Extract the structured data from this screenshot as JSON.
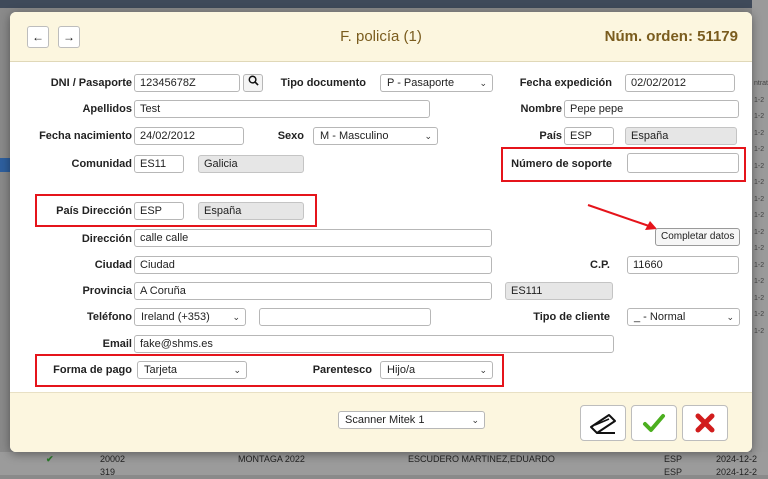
{
  "header": {
    "title": "F. policía (1)",
    "order_label": "Núm. orden: 51179",
    "prev_label": "←",
    "next_label": "→"
  },
  "form": {
    "dni_label": "DNI / Pasaporte",
    "dni_value": "12345678Z",
    "tipo_doc_label": "Tipo documento",
    "tipo_doc_value": "P - Pasaporte",
    "fecha_exp_label": "Fecha expedición",
    "fecha_exp_value": "02/02/2012",
    "apellidos_label": "Apellidos",
    "apellidos_value": "Test",
    "nombre_label": "Nombre",
    "nombre_value": "Pepe pepe",
    "fecha_nac_label": "Fecha nacimiento",
    "fecha_nac_value": "24/02/2012",
    "sexo_label": "Sexo",
    "sexo_value": "M - Masculino",
    "pais_label": "País",
    "pais_code": "ESP",
    "pais_name": "España",
    "comunidad_label": "Comunidad",
    "comunidad_code": "ES11",
    "comunidad_name": "Galicia",
    "num_soporte_label": "Número de soporte",
    "num_soporte_value": "",
    "pais_dir_label": "País Dirección",
    "pais_dir_code": "ESP",
    "pais_dir_name": "España",
    "completar_label": "Completar datos",
    "direccion_label": "Dirección",
    "direccion_value": "calle calle",
    "ciudad_label": "Ciudad",
    "ciudad_value": "Ciudad",
    "cp_label": "C.P.",
    "cp_value": "11660",
    "provincia_label": "Provincia",
    "provincia_value": "A Coruña",
    "provincia_code": "ES111",
    "telefono_label": "Teléfono",
    "telefono_prefix": "Ireland (+353)",
    "telefono_value": "",
    "tipo_cliente_label": "Tipo de cliente",
    "tipo_cliente_value": "_ - Normal",
    "email_label": "Email",
    "email_value": "fake@shms.es",
    "forma_pago_label": "Forma de pago",
    "forma_pago_value": "Tarjeta",
    "parentesco_label": "Parentesco",
    "parentesco_value": "Hijo/a"
  },
  "footer": {
    "scanner_value": "Scanner Mitek 1"
  },
  "background": {
    "right_labels": [
      "ntrat",
      "1-2",
      "1-2",
      "1-2",
      "1-2",
      "1-2",
      "1-2",
      "1-2",
      "1-2",
      "1-2",
      "1-2",
      "1-2",
      "1-2",
      "1-2",
      "1-2",
      "1-2"
    ],
    "row1": {
      "col1": "20002",
      "col2": "MONTAGA 2022",
      "col3": "ESCUDERO MARTINEZ,EDUARDO",
      "col4": "ESP",
      "col5": "2024-12-2"
    },
    "row2": {
      "col1": "319",
      "col2": "",
      "col3": "",
      "col4": "ESP",
      "col5": "2024-12-2"
    }
  },
  "colors": {
    "header_bg": "#fcf6df",
    "title_color": "#7a5c1e",
    "highlight_red": "#e5141b",
    "confirm_green": "#4caf1f",
    "cancel_red": "#d11d1d"
  }
}
